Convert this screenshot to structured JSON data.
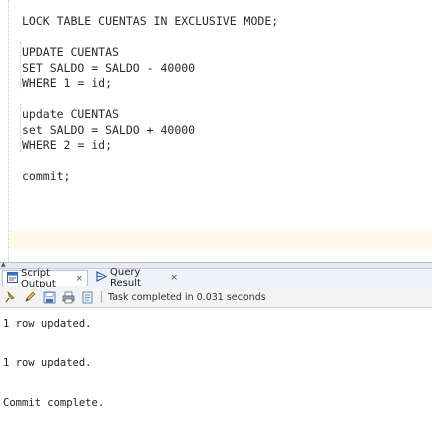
{
  "editor": {
    "lines": [
      "LOCK TABLE CUENTAS IN EXCLUSIVE MODE;",
      "",
      "UPDATE CUENTAS",
      "SET SALDO = SALDO - 40000",
      "WHERE 1 = id;",
      "",
      "update CUENTAS",
      "set SALDO = SALDO + 40000",
      "WHERE 2 = id;",
      "",
      "commit;"
    ]
  },
  "tabs": [
    {
      "label": "Script Output",
      "close": "×",
      "icon": "script-output-icon"
    },
    {
      "label": "Query Result",
      "close": "×",
      "icon": "query-result-icon"
    }
  ],
  "toolbar": {
    "icons": [
      "pin-icon",
      "pencil-icon",
      "save-icon",
      "print-icon",
      "clear-icon"
    ],
    "status": "Task completed in 0.031 seconds"
  },
  "output": {
    "lines": [
      "1 row updated.",
      "1 row updated.",
      "Commit complete."
    ]
  },
  "colors": {
    "current_line": "#fffbe6",
    "tab_border": "#b7c2d0"
  }
}
